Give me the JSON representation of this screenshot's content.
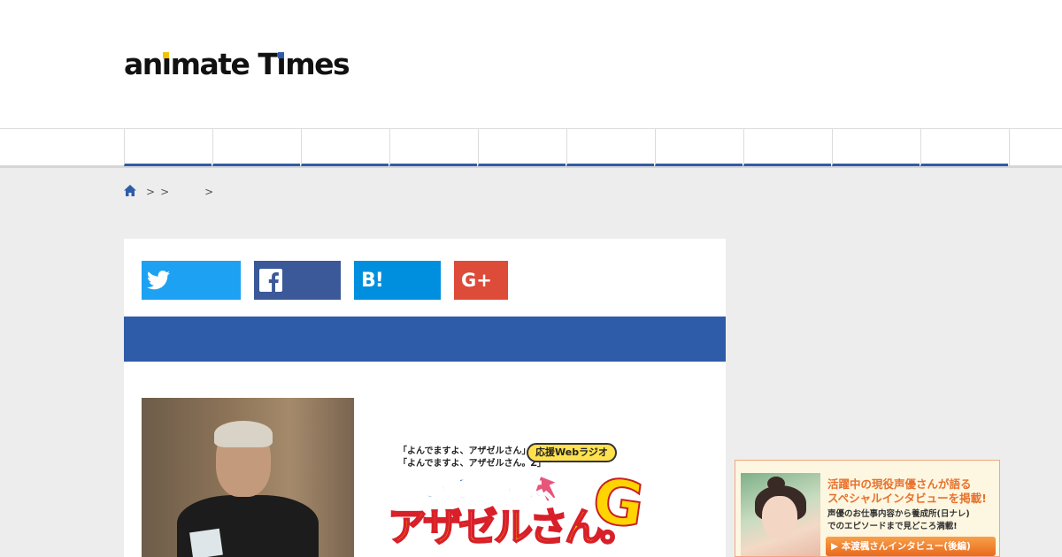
{
  "header": {
    "logo_part1": "an",
    "logo_i1": "ı",
    "logo_part2": "mate T",
    "logo_i2": "ı",
    "logo_part3": "mes",
    "brand_colors": {
      "blue": "#2f5ca8",
      "yellow": "#f2c200"
    }
  },
  "nav": {
    "item_count": 10,
    "active_underline_color": "#2f5ca8"
  },
  "breadcrumb": {
    "home_icon": "home-icon",
    "separators": [
      ">",
      ">",
      ">"
    ]
  },
  "share": {
    "twitter_icon": "twitter-bird-icon",
    "facebook_icon": "facebook-f-icon",
    "hatena_label": "B!",
    "googleplus_label": "G+",
    "colors": {
      "twitter": "#1da1f2",
      "facebook": "#3b5998",
      "hatena": "#008fde",
      "googleplus": "#dd4b39"
    }
  },
  "article": {
    "title_band_color": "#2f5ca8"
  },
  "radio_logo": {
    "sub1": "「よんでますよ、アザゼルさん」&",
    "sub2": "「よんでますよ、アザゼルさん。Z」",
    "badge": "応援Webラジオ",
    "line1": "きいてますよ、",
    "line2": "アザゼルさん。",
    "big_letter": "G"
  },
  "banner": {
    "headline1": "活躍中の現役声優さんが語る",
    "headline2": "スペシャルインタビューを掲載!",
    "body1": "声優のお仕事内容から養成所(日ナレ)",
    "body2": "でのエピソードまで見どころ満載!",
    "cta": "▶ 本渡楓さんインタビュー(後編)"
  }
}
